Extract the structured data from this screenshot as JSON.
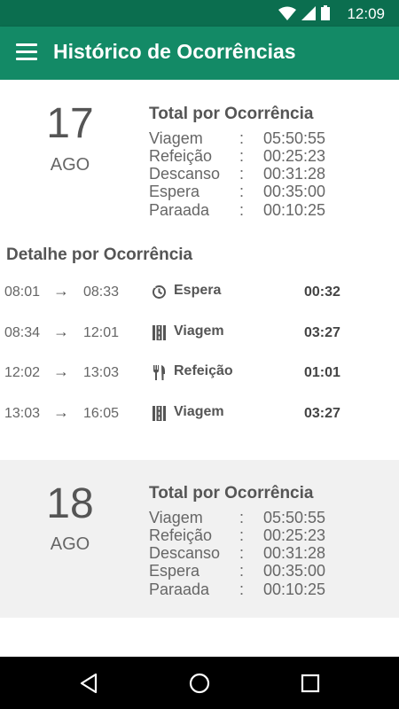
{
  "status": {
    "time": "12:09"
  },
  "appbar": {
    "title": "Histórico de Ocorrências"
  },
  "day1": {
    "day": "17",
    "month": "AGO",
    "totals_title": "Total por Ocorrência",
    "totals": [
      {
        "name": "Viagem",
        "value": "05:50:55"
      },
      {
        "name": "Refeição",
        "value": "00:25:23"
      },
      {
        "name": "Descanso",
        "value": "00:31:28"
      },
      {
        "name": "Espera",
        "value": "00:35:00"
      },
      {
        "name": "Paraada",
        "value": "00:10:25"
      }
    ]
  },
  "detail": {
    "title": "Detalhe por Ocorrência",
    "arrow": "→",
    "rows": [
      {
        "start": "08:01",
        "end": "08:33",
        "icon": "clock-icon",
        "label": "Espera",
        "duration": "00:32"
      },
      {
        "start": "08:34",
        "end": "12:01",
        "icon": "road-icon",
        "label": "Viagem",
        "duration": "03:27"
      },
      {
        "start": "12:02",
        "end": "13:03",
        "icon": "cutlery-icon",
        "label": "Refeição",
        "duration": "01:01"
      },
      {
        "start": "13:03",
        "end": "16:05",
        "icon": "road-icon",
        "label": "Viagem",
        "duration": "03:27"
      }
    ]
  },
  "day2": {
    "day": "18",
    "month": "AGO",
    "totals_title": "Total por Ocorrência",
    "totals": [
      {
        "name": "Viagem",
        "value": "05:50:55"
      },
      {
        "name": "Refeição",
        "value": "00:25:23"
      },
      {
        "name": "Descanso",
        "value": "00:31:28"
      },
      {
        "name": "Espera",
        "value": "00:35:00"
      },
      {
        "name": "Paraada",
        "value": "00:10:25"
      }
    ]
  },
  "colors": {
    "status_bar": "#0b6e4f",
    "app_bar": "#138a66",
    "day_alt_bg": "#f1f1f1"
  },
  "totals_separator": ":"
}
